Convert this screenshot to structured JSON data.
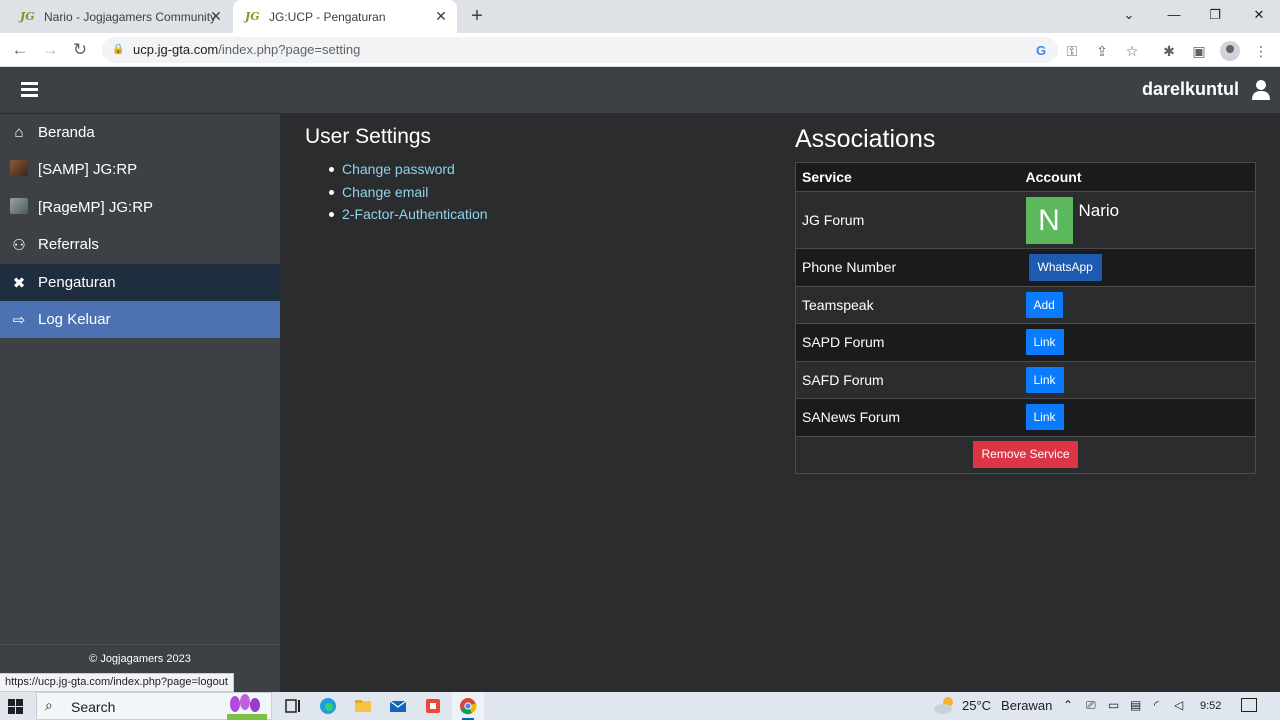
{
  "browser": {
    "tabs": [
      {
        "favicon": "JG",
        "title": "Nario - Jogjagamers Community",
        "close": "✕"
      },
      {
        "favicon": "JG",
        "title": "JG:UCP - Pengaturan",
        "close": "✕"
      }
    ],
    "new_tab": "+",
    "window_controls": {
      "tab_search": "⌄",
      "minimize": "—",
      "restore": "❐",
      "close": "✕"
    },
    "url_domain": "ucp.jg-gta.com",
    "url_path": "/index.php?page=setting",
    "nav": {
      "back": "←",
      "forward": "→",
      "reload": "↻"
    },
    "google_icon_text": "G"
  },
  "header": {
    "username": "darelkuntul"
  },
  "sidebar": {
    "items": [
      {
        "label": "Beranda",
        "icon": "home-icon",
        "glyph": "⌂"
      },
      {
        "label": "[SAMP] JG:RP",
        "icon": "samp-icon",
        "glyph": ""
      },
      {
        "label": "[RageMP] JG:RP",
        "icon": "ragemp-icon",
        "glyph": ""
      },
      {
        "label": "Referrals",
        "icon": "handshake-icon",
        "glyph": "⚇"
      },
      {
        "label": "Pengaturan",
        "icon": "tools-icon",
        "glyph": "✖"
      },
      {
        "label": "Log Keluar",
        "icon": "sign-out-icon",
        "glyph": "⇨"
      }
    ],
    "footer": "© Jogjagamers 2023",
    "colors": {
      "active": "#1f2e3f",
      "hover": "#4d72b3"
    }
  },
  "settings": {
    "title": "User Settings",
    "links": [
      "Change password",
      "Change email",
      "2-Factor-Authentication"
    ]
  },
  "associations": {
    "title": "Associations",
    "headers": {
      "service": "Service",
      "account": "Account"
    },
    "rows": {
      "jg_forum": {
        "service": "JG Forum",
        "avatar_letter": "N",
        "account": "Nario"
      },
      "phone": {
        "service": "Phone Number",
        "button": "WhatsApp"
      },
      "teamspeak": {
        "service": "Teamspeak",
        "button": "Add"
      },
      "sapd": {
        "service": "SAPD Forum",
        "button": "Link"
      },
      "safd": {
        "service": "SAFD Forum",
        "button": "Link"
      },
      "sanews": {
        "service": "SANews Forum",
        "button": "Link"
      }
    },
    "remove_button": "Remove Service",
    "colors": {
      "link_button": "#0a7bff",
      "whatsapp_button": "#1e5bb0",
      "remove_button": "#dc3545",
      "avatar": "#5cb85c"
    }
  },
  "status_url": "https://ucp.jg-gta.com/index.php?page=logout",
  "taskbar": {
    "search_placeholder": "Search",
    "weather_temp": "25°C",
    "weather_desc": "Berawan",
    "clock": "9:52"
  }
}
